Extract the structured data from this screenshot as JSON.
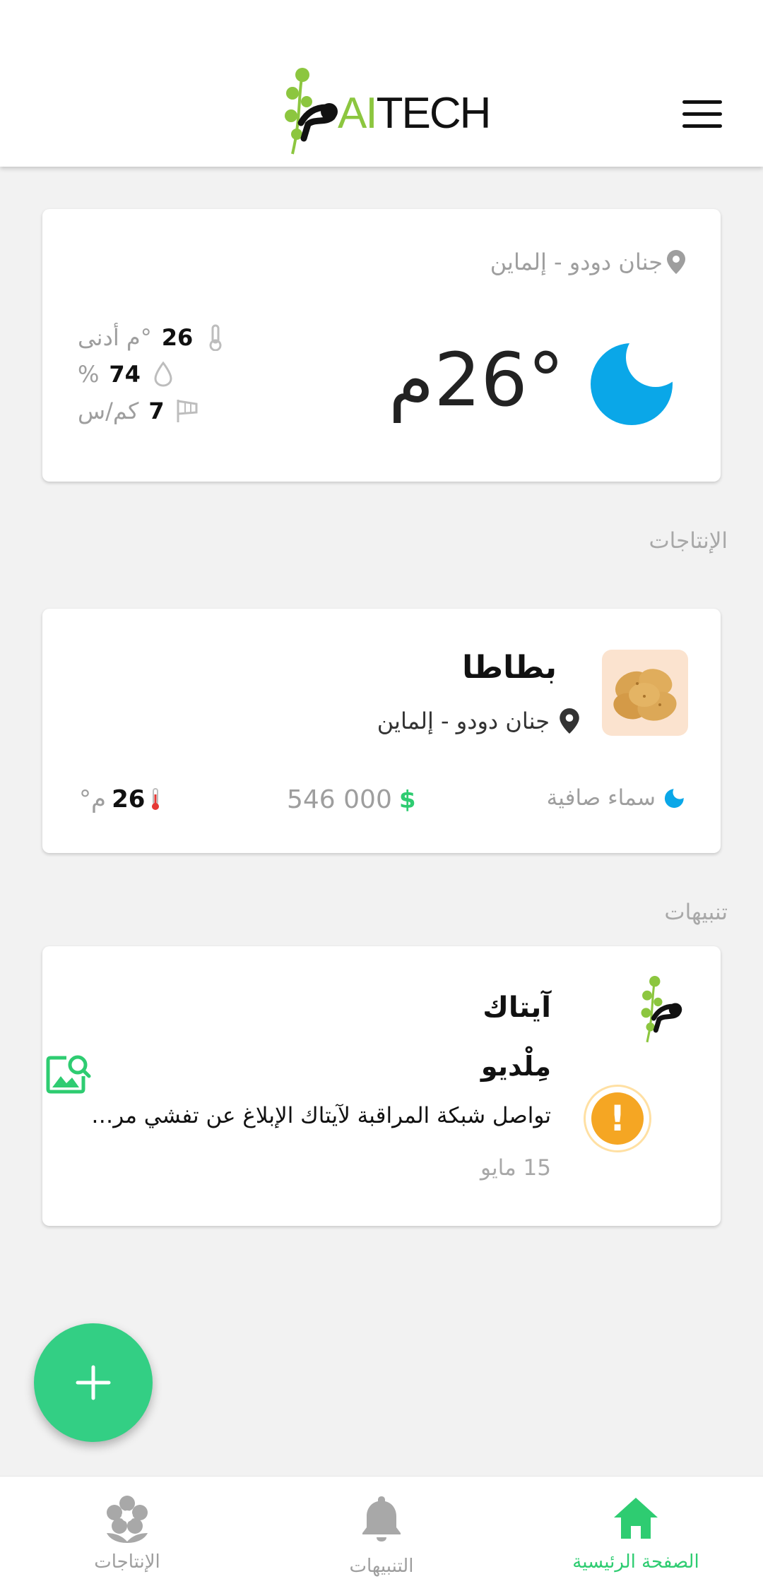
{
  "header": {
    "logo_ai": "AI",
    "logo_tech": "TECH",
    "menu_icon": "hamburger-menu-icon"
  },
  "weather": {
    "location": "جنان دودو - إلماين",
    "temperature": "26°م",
    "condition_icon": "crescent-moon-icon",
    "min_temp_value": "26",
    "min_temp_unit": "°م أدنى",
    "humidity_value": "74",
    "humidity_unit": "%",
    "wind_value": "7",
    "wind_unit": "كم/س",
    "icon_color": "#0aa7e8"
  },
  "productions": {
    "section_title": "الإنتاجات",
    "items": [
      {
        "name": "بطاطا",
        "location": "جنان دودو - إلماين",
        "sky": "سماء صافية",
        "price_symbol": "$",
        "price": "546 000",
        "temp_value": "26",
        "temp_unit": "°م"
      }
    ]
  },
  "alerts": {
    "section_title": "تنبيهات",
    "items": [
      {
        "brand": "آيتاك",
        "type": "مِلْديو",
        "message": "تواصل شبكة المراقبة لآيتاك الإبلاغ عن تفشي مرض...",
        "date": "15 مايو",
        "severity_icon": "!"
      }
    ]
  },
  "fab": {
    "label": "+"
  },
  "bottom_nav": [
    {
      "label": "الصفحة الرئيسية",
      "icon": "home-icon",
      "active": true
    },
    {
      "label": "التنبيهات",
      "icon": "bell-icon",
      "active": false
    },
    {
      "label": "الإنتاجات",
      "icon": "flower-icon",
      "active": false
    }
  ],
  "colors": {
    "accent_green": "#2ecc71",
    "fab_green": "#33cf84",
    "logo_green": "#8cc63f",
    "sky_blue": "#0aa7e8",
    "warning_orange": "#f5a623"
  }
}
